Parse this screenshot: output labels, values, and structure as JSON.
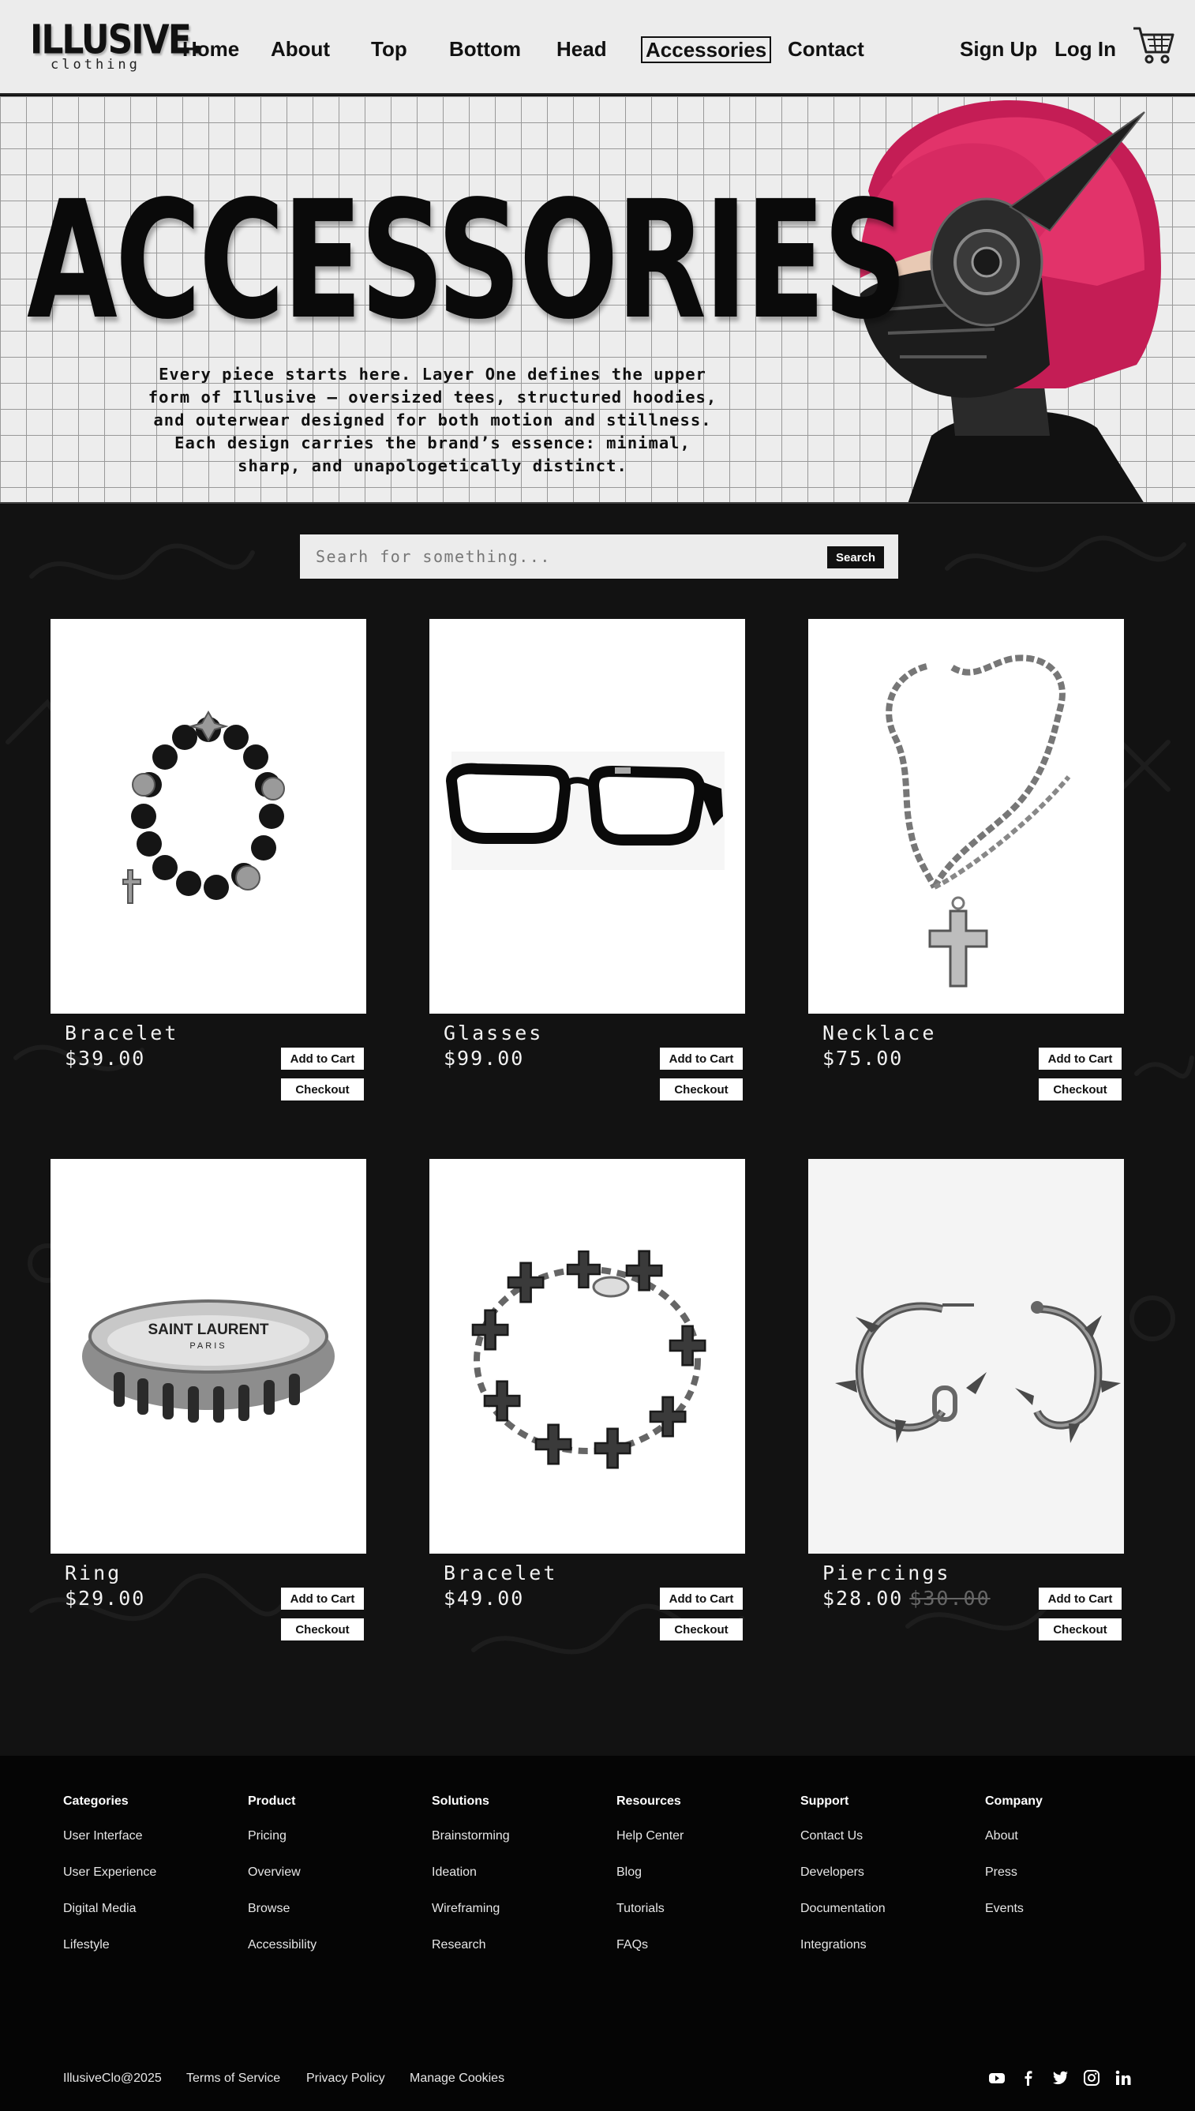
{
  "nav": {
    "logo_main": "ILLUSIVE.",
    "logo_sub": "clothing",
    "links": [
      "Home",
      "About",
      "Top",
      "Bottom",
      "Head",
      "Accessories",
      "Contact"
    ],
    "active": "Accessories",
    "sign_up": "Sign Up",
    "log_in": "Log In",
    "cart_icon": "shopping-cart-icon"
  },
  "hero": {
    "title": "ACCESSORIES",
    "description": "Every piece starts here. Layer One defines the upper form of Illusive — oversized tees, structured hoodies, and outerwear designed for both motion and stillness. Each design carries the brand’s essence: minimal, sharp, and unapologetically distinct.",
    "image": "model-with-pink-hair-and-mask"
  },
  "search": {
    "placeholder": "Searh for something...",
    "button": "Search"
  },
  "products": [
    {
      "name": "Bracelet",
      "price": "$39.00",
      "old_price": "",
      "image": "beaded-bracelet",
      "add_to_cart": "Add to Cart",
      "checkout": "Checkout"
    },
    {
      "name": "Glasses",
      "price": "$99.00",
      "old_price": "",
      "image": "black-glasses",
      "add_to_cart": "Add to Cart",
      "checkout": "Checkout"
    },
    {
      "name": "Necklace",
      "price": "$75.00",
      "old_price": "",
      "image": "cross-necklace",
      "add_to_cart": "Add to Cart",
      "checkout": "Checkout"
    },
    {
      "name": "Ring",
      "price": "$29.00",
      "old_price": "",
      "image": "saint-laurent-ring",
      "ring_text": "SAINT LAURENT",
      "ring_subtext": "PARIS",
      "add_to_cart": "Add to Cart",
      "checkout": "Checkout"
    },
    {
      "name": "Bracelet",
      "price": "$49.00",
      "old_price": "",
      "image": "cross-link-bracelet",
      "add_to_cart": "Add to Cart",
      "checkout": "Checkout"
    },
    {
      "name": "Piercings",
      "price": "$28.00",
      "old_price": "$30.00",
      "image": "spiked-hoop-earrings",
      "add_to_cart": "Add to Cart",
      "checkout": "Checkout"
    }
  ],
  "footer": {
    "columns": [
      {
        "heading": "Categories",
        "items": [
          "User Interface",
          "User Experience",
          "Digital Media",
          "Lifestyle"
        ]
      },
      {
        "heading": "Product",
        "items": [
          "Pricing",
          "Overview",
          "Browse",
          "Accessibility"
        ]
      },
      {
        "heading": "Solutions",
        "items": [
          "Brainstorming",
          "Ideation",
          "Wireframing",
          "Research"
        ]
      },
      {
        "heading": "Resources",
        "items": [
          "Help Center",
          "Blog",
          "Tutorials",
          "FAQs"
        ]
      },
      {
        "heading": "Support",
        "items": [
          "Contact Us",
          "Developers",
          "Documentation",
          "Integrations"
        ]
      },
      {
        "heading": "Company",
        "items": [
          "About",
          "Press",
          "Events"
        ]
      }
    ],
    "copyright": "IllusiveClo@2025",
    "legal": [
      "Terms of Service",
      "Privacy Policy",
      "Manage Cookies"
    ],
    "social": [
      "youtube-icon",
      "facebook-icon",
      "twitter-icon",
      "instagram-icon",
      "linkedin-icon"
    ]
  },
  "colors": {
    "nav_bg": "#ececec",
    "main_bg": "#121212",
    "footer_bg": "#050505",
    "hair": "#d8245e"
  }
}
